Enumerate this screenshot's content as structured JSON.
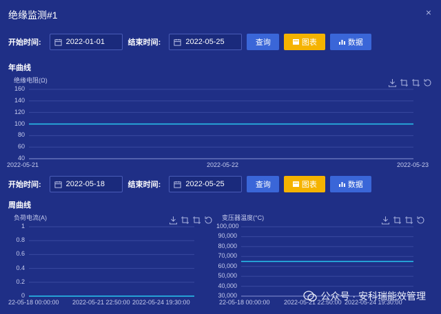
{
  "window": {
    "title": "绝缘监测#1",
    "close_label": "×"
  },
  "filters": {
    "start_label": "开始时间:",
    "end_label": "结束时间:",
    "query_label": "查询",
    "chart_label": "图表",
    "data_label": "数据",
    "row1": {
      "start": "2022-01-01",
      "end": "2022-05-25"
    },
    "row2": {
      "start": "2022-05-18",
      "end": "2022-05-25"
    }
  },
  "sections": {
    "year": "年曲线",
    "week": "周曲线"
  },
  "colors": {
    "background": "#1f2f86",
    "series": "#28c8f0",
    "query_btn": "#3a66d8",
    "chart_btn": "#f5b300",
    "grid": "#3a4aa0"
  },
  "chart_data": [
    {
      "type": "line",
      "ylabel": "绝缘电阻(Ω)",
      "ylim": [
        40,
        160
      ],
      "yticks": [
        "160",
        "140",
        "120",
        "100",
        "80",
        "60",
        "40"
      ],
      "x": [
        "2022-05-21",
        "2022-05-22",
        "2022-05-23"
      ],
      "series": [
        {
          "values": [
            100,
            100,
            100
          ]
        }
      ]
    },
    {
      "type": "line",
      "ylabel": "负荷电流(A)",
      "ylim": [
        0,
        1
      ],
      "yticks": [
        "1",
        "0.8",
        "0.6",
        "0.4",
        "0.2",
        "0"
      ],
      "x": [
        "22-05-18 00:00:00",
        "2022-05-21 22:50:00",
        "2022-05-24 19:30:00"
      ],
      "series": [
        {
          "values": [
            0,
            0,
            0
          ]
        }
      ]
    },
    {
      "type": "line",
      "ylabel": "变压器温度(°C)",
      "ylim": [
        30000,
        100000
      ],
      "yticks": [
        "100,000",
        "90,000",
        "80,000",
        "70,000",
        "60,000",
        "50,000",
        "40,000",
        "30,000"
      ],
      "x": [
        "22-05-18 00:00:00",
        "2022-05-21 22:50:00",
        "2022-05-24 19:30:00"
      ],
      "series": [
        {
          "values": [
            65000,
            65000,
            65000
          ]
        }
      ]
    }
  ],
  "watermark": {
    "text": "公众号 · 安科瑞能效管理"
  }
}
